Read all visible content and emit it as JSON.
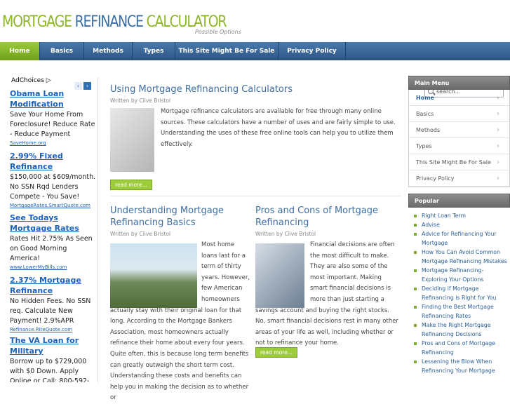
{
  "header": {
    "logo_word1": "MORTGAGE",
    "logo_word2": "REFINANCE",
    "logo_word3": "CALCULATOR",
    "tagline": "Possible Options"
  },
  "nav": {
    "items": [
      "Home",
      "Basics",
      "Methods",
      "Types",
      "This Site Might Be For Sale",
      "Privacy Policy"
    ],
    "active": "Home"
  },
  "search": {
    "placeholder": "search..."
  },
  "ads": {
    "adchoices": "AdChoices",
    "items": [
      {
        "title": "Obama Loan Modification",
        "body": "Save Your Home From Foreclosure! Reduce Rate - Reduce Payment",
        "url": "SaveHome.org"
      },
      {
        "title": "2.99% Fixed Refinance",
        "body": "$150,000 at $609/month. No SSN Rqd Lenders Compete - You Save!",
        "url": "MortgageRates.SmartQuote.com"
      },
      {
        "title": "See Todays Mortgage Rates",
        "body": "Rates Hit 2.75% As Seen on Good Morning America!",
        "url": "www.LowerMyBills.com"
      },
      {
        "title": "2.37% Mortgage Refinance",
        "body": "No Hidden Fees. No SSN req. Calculate New Payment! 2.9%APR",
        "url": "Refinance.RiteQuote.com"
      },
      {
        "title": "The VA Loan for Military",
        "body": "Borrow up to $729,000 with $0 Down. Apply Online or Call: 800-592-",
        "url": ""
      }
    ]
  },
  "posts": [
    {
      "title": "Using Mortgage Refinancing Calculators",
      "byline": "Written by Clive Bristol",
      "text": "Mortgage refinance calculators are available for free through many online sources. These calculators have a number of uses and are fairly simple to use. Understanding the uses of these free online tools can help you to utilize them effectively.",
      "read_more": "read more..."
    },
    {
      "title": "Understanding Mortgage Refinancing Basics",
      "byline": "Written by Clive Bristol",
      "text": "Most home loans last for a term of thirty years. However, few American homeowners actually stay with their original loan for that long. According to the Mortgage Bankers Association, most homeowners actually refinance their home about every four years. Quite often, this is because long term benefits can greatly outweigh the short term cost. Understanding these costs and benefits can help you in making the decision as to whether or",
      "read_more": ""
    },
    {
      "title": "Pros and Cons of Mortgage Refinancing",
      "byline": "Written by Clive Bristol",
      "text": "Financial decisions are often the most difficult to make. They are also some of the most important. Making smart financial decisions is more than just starting a savings account and buying the right stocks. No, smart financial decisions rest in many other areas of your life as well, including whether or not to refinance your home.",
      "read_more": "read more..."
    }
  ],
  "sidebar": {
    "main_menu_title": "Main Menu",
    "main_menu": [
      "Home",
      "Basics",
      "Methods",
      "Types",
      "This Site Might Be For Sale",
      "Privacy Policy"
    ],
    "popular_title": "Popular",
    "popular": [
      "Right Loan Term",
      "Advise",
      "Advice for Refinancing Your Mortgage",
      "How You Can Avoid Common Mortgage Refinancing Mistakes",
      "Mortgage Refinancing- Exploring Your Options",
      "Deciding if Mortgage Refinancing is Right for You",
      "Finding the Best Mortgage Refinancing Rates",
      "Make the Right Mortgage Refinancing Decisions",
      "Pros and Cons of Mortgage Refinancing",
      "Lessening the Blow When Refinancing Your Mortgage"
    ]
  },
  "colors": {
    "nav_blue": "#3d6a9c",
    "accent_green": "#8db62a",
    "link_blue": "#2a5f97"
  }
}
